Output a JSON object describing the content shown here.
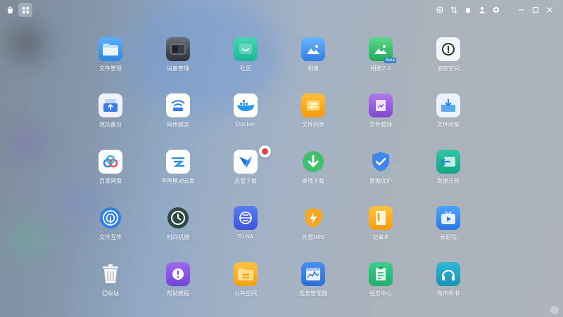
{
  "topbar": {
    "left_buttons": [
      {
        "icon": "store-icon"
      },
      {
        "icon": "app-grid-icon",
        "active": true
      }
    ],
    "right_icons": [
      "screenshot-icon",
      "sort-icon",
      "bell-icon",
      "user-icon",
      "settings-icon"
    ],
    "window_controls": [
      "minimize-icon",
      "maximize-icon",
      "close-icon"
    ]
  },
  "apps": [
    {
      "label": "文件管理"
    },
    {
      "label": "设备管理"
    },
    {
      "label": "社区"
    },
    {
      "label": "相册"
    },
    {
      "label": "相册2.0",
      "badge": "Beta"
    },
    {
      "label": "加密空间"
    },
    {
      "label": "我的备份"
    },
    {
      "label": "网络服务"
    },
    {
      "label": "Docker"
    },
    {
      "label": "文件同步"
    },
    {
      "label": "文件整理"
    },
    {
      "label": "文件收集"
    },
    {
      "label": "百度网盘"
    },
    {
      "label": "中国移动云盘"
    },
    {
      "label": "迅雷下载"
    },
    {
      "label": "离线下载"
    },
    {
      "label": "数据保护"
    },
    {
      "label": "数据迁移"
    },
    {
      "label": "文件互传"
    },
    {
      "label": "时间机器"
    },
    {
      "label": "DLNA"
    },
    {
      "label": "外置UPS"
    },
    {
      "label": "记事本"
    },
    {
      "label": "云影院"
    },
    {
      "label": "回收站"
    },
    {
      "label": "帮助教程"
    },
    {
      "label": "公共空间"
    },
    {
      "label": "任务管理器"
    },
    {
      "label": "任务中心"
    },
    {
      "label": "有声听书"
    }
  ],
  "colors": {
    "accent": "#3a83c9",
    "badge_red": "#e0443c"
  }
}
